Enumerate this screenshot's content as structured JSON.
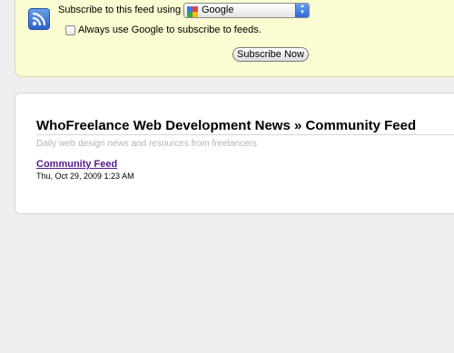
{
  "subscribe": {
    "label": "Subscribe to this feed using",
    "reader_selected": "Google",
    "always_use_label": "Always use Google to subscribe to feeds.",
    "always_use_checked": false,
    "button_label": "Subscribe Now",
    "rss_icon": "rss-feed-icon",
    "reader_icon": "google-icon"
  },
  "feed": {
    "title": "WhoFreelance Web Development News » Community Feed",
    "subtitle": "Daily web design news and resources from freelancers",
    "entries": [
      {
        "title": "Community Feed",
        "date": "Thu, Oct 29, 2009 1:23 AM"
      }
    ]
  },
  "colors": {
    "subscribe_bg": "#fcfcd2",
    "page_bg": "#efefef",
    "visited_link": "#551a8b",
    "subtitle_gray": "#b4b4b4"
  }
}
